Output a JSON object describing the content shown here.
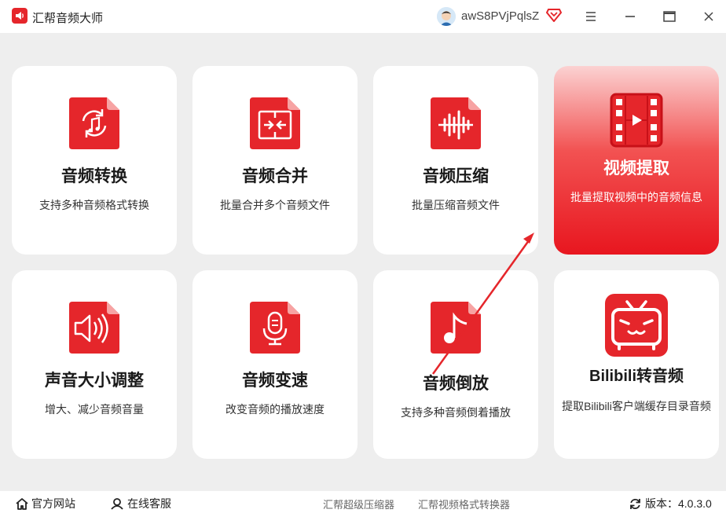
{
  "window": {
    "title": "汇帮音频大师",
    "username": "awS8PVjPqlsZ"
  },
  "cards": [
    {
      "name": "音频转换",
      "desc": "支持多种音频格式转换",
      "icon": "audio-convert-icon"
    },
    {
      "name": "音频合并",
      "desc": "批量合并多个音频文件",
      "icon": "audio-merge-icon"
    },
    {
      "name": "音频压缩",
      "desc": "批量压缩音频文件",
      "icon": "audio-compress-icon"
    },
    {
      "name": "视频提取",
      "desc": "批量提取视频中的音频信息",
      "icon": "video-extract-icon",
      "active": true
    },
    {
      "name": "声音大小调整",
      "desc": "增大、减少音频音量",
      "icon": "volume-adjust-icon"
    },
    {
      "name": "音频变速",
      "desc": "改变音频的播放速度",
      "icon": "audio-speed-icon"
    },
    {
      "name": "音频倒放",
      "desc": "支持多种音频倒着播放",
      "icon": "audio-reverse-icon"
    },
    {
      "name": "Bilibili转音频",
      "desc": "提取Bilibili客户端缓存目录音频",
      "icon": "bilibili-icon"
    }
  ],
  "footer": {
    "website": "官方网站",
    "support": "在线客服",
    "link1": "汇帮超级压缩器",
    "link2": "汇帮视频格式转换器",
    "version": "版本：4.0.3.0"
  },
  "colors": {
    "accent": "#e5262b",
    "background": "#eeeeee"
  }
}
